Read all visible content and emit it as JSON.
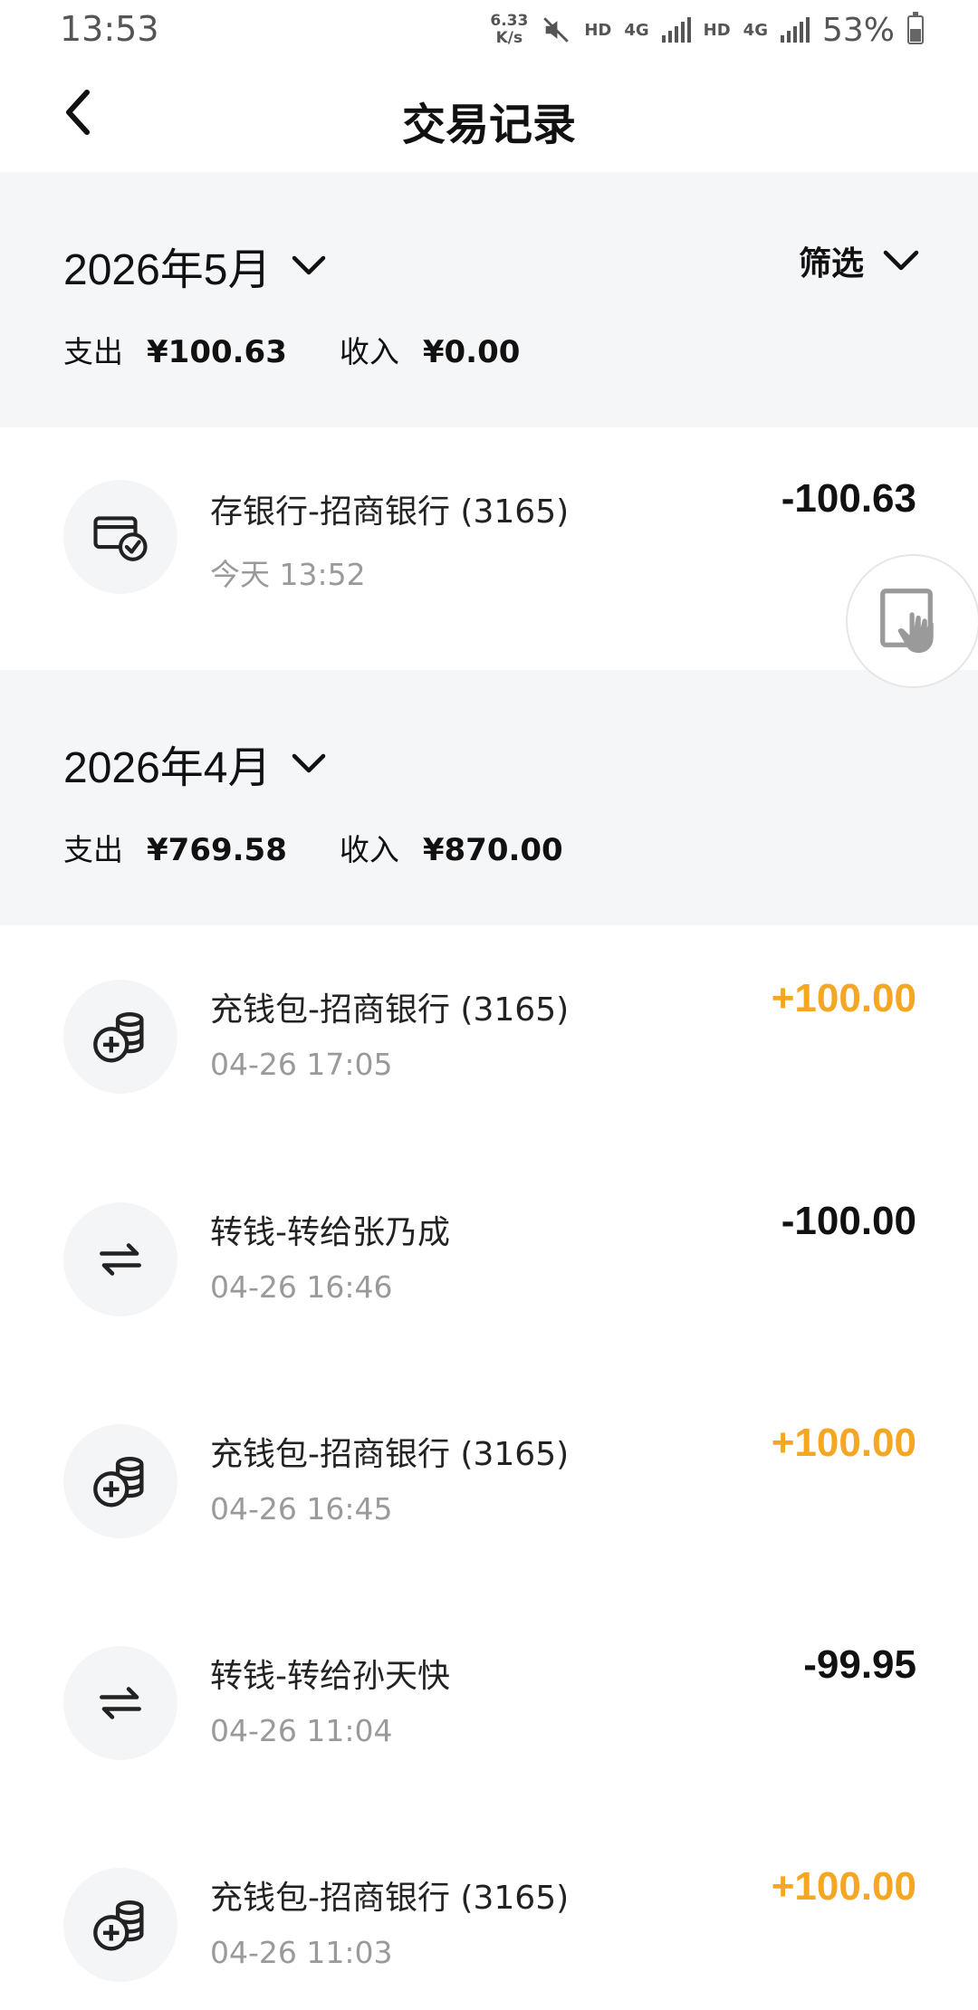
{
  "status_bar": {
    "time": "13:53",
    "net_speed_value": "6.33",
    "net_speed_unit": "K/s",
    "hd1": "HD",
    "net1": "4G",
    "hd2": "HD",
    "net2": "4G",
    "battery_pct": "53%",
    "battery_level": 0.53
  },
  "header": {
    "title": "交易记录",
    "back_icon": "chevron-left-icon"
  },
  "filter_label": "筛选",
  "months": [
    {
      "label": "2026年5月",
      "expense_label": "支出",
      "expense": "¥100.63",
      "income_label": "收入",
      "income": "¥0.00",
      "transactions": [
        {
          "icon": "card-check-icon",
          "title": "存银行-招商银行 (3165)",
          "time": "今天 13:52",
          "amount": "-100.63",
          "type": "expense"
        }
      ]
    },
    {
      "label": "2026年4月",
      "expense_label": "支出",
      "expense": "¥769.58",
      "income_label": "收入",
      "income": "¥870.00",
      "transactions": [
        {
          "icon": "coins-plus-icon",
          "title": "充钱包-招商银行 (3165)",
          "time": "04-26 17:05",
          "amount": "+100.00",
          "type": "income"
        },
        {
          "icon": "transfer-arrows-icon",
          "title": "转钱-转给张乃成",
          "time": "04-26 16:46",
          "amount": "-100.00",
          "type": "expense"
        },
        {
          "icon": "coins-plus-icon",
          "title": "充钱包-招商银行 (3165)",
          "time": "04-26 16:45",
          "amount": "+100.00",
          "type": "income"
        },
        {
          "icon": "transfer-arrows-icon",
          "title": "转钱-转给孙天快",
          "time": "04-26 11:04",
          "amount": "-99.95",
          "type": "expense"
        },
        {
          "icon": "coins-plus-icon",
          "title": "充钱包-招商银行 (3165)",
          "time": "04-26 11:03",
          "amount": "+100.00",
          "type": "income"
        }
      ]
    }
  ],
  "colors": {
    "income": "#f5a623",
    "expense": "#111111",
    "section_bg": "#f5f6f8"
  },
  "floating_widget_icon": "touch-hand-icon"
}
